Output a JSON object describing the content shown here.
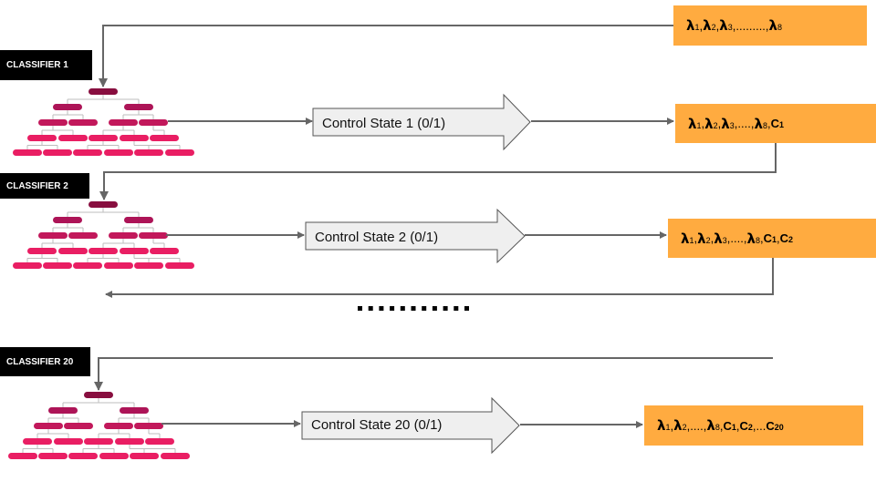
{
  "diagram": {
    "colors": {
      "output_box": "#ffab40",
      "root_node": "#880e3f",
      "level1_node": "#ad1457",
      "level2_node": "#c2185b",
      "leaf_node": "#e91e63",
      "connector": "#666666",
      "tree_edge": "#bdbdbd",
      "label_box": "#000000",
      "control_arrow_fill": "#efefef"
    },
    "input_box": {
      "parts": [
        {
          "t": "lam",
          "sub": "1"
        },
        {
          "t": "sep",
          "v": " , "
        },
        {
          "t": "lam",
          "sub": "2"
        },
        {
          "t": "sep",
          "v": " ,"
        },
        {
          "t": "lam",
          "sub": "3"
        },
        {
          "t": "sep",
          "v": " ,.........,"
        },
        {
          "t": "lam",
          "sub": "8"
        }
      ],
      "text": "λ1 , λ2 ,λ3 ,.........,λ8"
    },
    "stages": [
      {
        "classifier_label": "CLASSIFIER 1",
        "control_state_label": "Control State 1 (0/1)",
        "output_text": "λ1 , λ2 ,λ3 ,....,λ8 , C1",
        "output_parts": [
          {
            "t": "lam",
            "sub": "1"
          },
          {
            "t": "sep",
            "v": " , "
          },
          {
            "t": "lam",
            "sub": "2"
          },
          {
            "t": "sep",
            "v": " ,"
          },
          {
            "t": "lam",
            "sub": "3"
          },
          {
            "t": "sep",
            "v": " ,....,"
          },
          {
            "t": "lam",
            "sub": "8"
          },
          {
            "t": "sep",
            "v": " , "
          },
          {
            "t": "C",
            "sub": "1"
          }
        ]
      },
      {
        "classifier_label": "CLASSIFIER 2",
        "control_state_label": "Control State 2 (0/1)",
        "output_text": "λ1 , λ2 ,λ3 ,....,λ8 , C1 , C2",
        "output_parts": [
          {
            "t": "lam",
            "sub": "1"
          },
          {
            "t": "sep",
            "v": " , "
          },
          {
            "t": "lam",
            "sub": "2"
          },
          {
            "t": "sep",
            "v": " ,"
          },
          {
            "t": "lam",
            "sub": "3"
          },
          {
            "t": "sep",
            "v": " ,....,"
          },
          {
            "t": "lam",
            "sub": "8"
          },
          {
            "t": "sep",
            "v": " , "
          },
          {
            "t": "C",
            "sub": "1"
          },
          {
            "t": "sep",
            "v": " , "
          },
          {
            "t": "C",
            "sub": "2"
          }
        ]
      },
      {
        "classifier_label": "CLASSIFIER 20",
        "control_state_label": "Control State 20 (0/1)",
        "output_text": "λ1 , λ2 ,....,λ8 , C1 , C2 ,... C20",
        "output_parts": [
          {
            "t": "lam",
            "sub": "1"
          },
          {
            "t": "sep",
            "v": " , "
          },
          {
            "t": "lam",
            "sub": "2"
          },
          {
            "t": "sep",
            "v": " ,....,"
          },
          {
            "t": "lam",
            "sub": "8"
          },
          {
            "t": "sep",
            "v": " , "
          },
          {
            "t": "C",
            "sub": "1"
          },
          {
            "t": "sep",
            "v": " , "
          },
          {
            "t": "C",
            "sub": "2"
          },
          {
            "t": "sep",
            "v": " ,... "
          },
          {
            "t": "C",
            "sub": "20"
          }
        ]
      }
    ],
    "ellipsis": "..........."
  }
}
